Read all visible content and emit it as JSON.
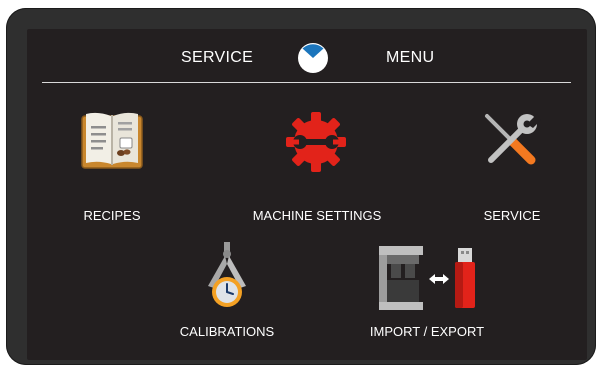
{
  "header": {
    "left_title": "SERVICE",
    "right_title": "MENU",
    "home_icon": "clock-home-icon"
  },
  "tiles": [
    {
      "label": "RECIPES",
      "icon": "recipe-book-icon"
    },
    {
      "label": "MACHINE SETTINGS",
      "icon": "gear-wrench-icon"
    },
    {
      "label": "SERVICE",
      "icon": "tools-icon"
    },
    {
      "label": "CALIBRATIONS",
      "icon": "caliper-clock-icon"
    },
    {
      "label": "IMPORT / EXPORT",
      "icon": "machine-usb-transfer-icon"
    }
  ],
  "colors": {
    "screen_bg": "#231f20",
    "bezel": "#2f2f2f",
    "accent_red": "#e2231a",
    "accent_orange": "#f47920",
    "accent_blue": "#1b75bc",
    "book_gold": "#c9872e"
  }
}
